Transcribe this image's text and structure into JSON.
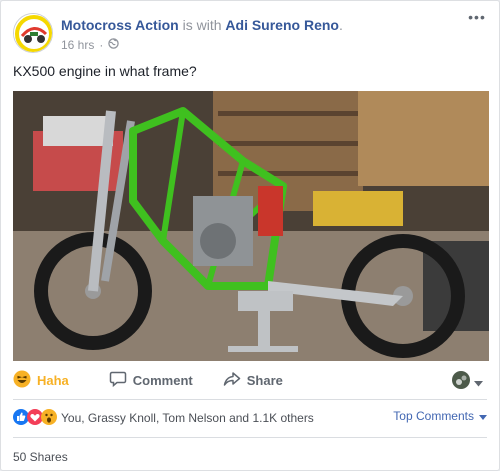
{
  "post": {
    "page_name": "Motocross Action",
    "with_text": "is with",
    "tagged_name": "Adi Sureno Reno",
    "time": "16 hrs",
    "separator": "·",
    "text": "KX500 engine in what frame?"
  },
  "actions": {
    "haha_label": "Haha",
    "comment_label": "Comment",
    "share_label": "Share"
  },
  "reactions": {
    "summary": "You, Grassy Knoll, Tom Nelson and 1.1K others",
    "top_comments_label": "Top Comments"
  },
  "shares": "50 Shares",
  "colors": {
    "link": "#365899",
    "haha": "#f7b125",
    "bike_frame": "#3fc01f",
    "like": "#1877f2",
    "love": "#f33e58"
  },
  "icons": [
    "globe-icon",
    "more-icon",
    "haha-icon",
    "comment-icon",
    "share-icon",
    "like-icon",
    "love-icon",
    "wow-icon",
    "chevron-down-icon"
  ]
}
